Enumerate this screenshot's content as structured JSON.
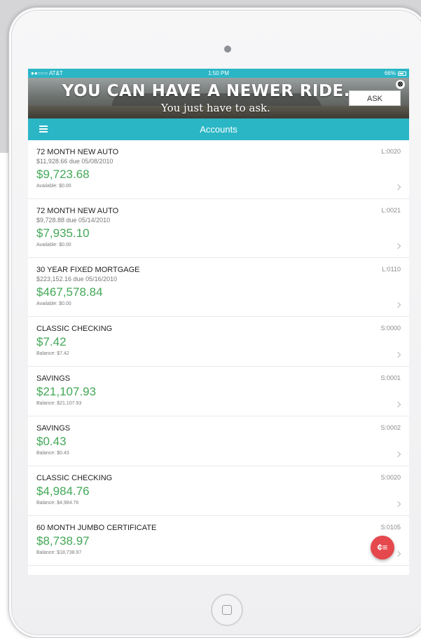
{
  "status_bar": {
    "carrier": "●●○○○ AT&T",
    "time": "1:50 PM",
    "battery": "66%"
  },
  "banner": {
    "headline": "YOU CAN HAVE A NEWER RIDE.",
    "subline": "You just have to ask.",
    "ask_label": "ASK",
    "close_glyph": "⊗"
  },
  "navbar": {
    "title": "Accounts",
    "menu_icon": "hamburger-menu-icon"
  },
  "accounts": [
    {
      "name": "72 MONTH NEW AUTO",
      "due": "$11,928.66 due 05/08/2010",
      "amount": "$9,723.68",
      "sub": "Available: $0.00",
      "code": "L:0020"
    },
    {
      "name": "72 MONTH NEW AUTO",
      "due": "$9,728.88 due 05/14/2010",
      "amount": "$7,935.10",
      "sub": "Available: $0.00",
      "code": "L:0021"
    },
    {
      "name": "30 YEAR FIXED MORTGAGE",
      "due": "$223,152.16 due 05/16/2010",
      "amount": "$467,578.84",
      "sub": "Available: $0.00",
      "code": "L:0110"
    },
    {
      "name": "CLASSIC CHECKING",
      "amount": "$7.42",
      "sub": "Balance: $7.42",
      "code": "S:0000"
    },
    {
      "name": "SAVINGS",
      "amount": "$21,107.93",
      "sub": "Balance: $21,107.93",
      "code": "S:0001"
    },
    {
      "name": "SAVINGS",
      "amount": "$0.43",
      "sub": "Balance: $0.43",
      "code": "S:0002"
    },
    {
      "name": "CLASSIC CHECKING",
      "amount": "$4,984.76",
      "sub": "Balance: $4,984.76",
      "code": "S:0020"
    },
    {
      "name": "60 MONTH JUMBO CERTIFICATE",
      "amount": "$8,738.97",
      "sub": "Balance: $18,738.97",
      "code": "S:0105"
    }
  ],
  "fab": {
    "icon": "coins-icon",
    "glyph": "¢≡"
  },
  "colors": {
    "accent": "#2bb6c6",
    "amount_green": "#43a857",
    "fab_red": "#e5484d"
  }
}
